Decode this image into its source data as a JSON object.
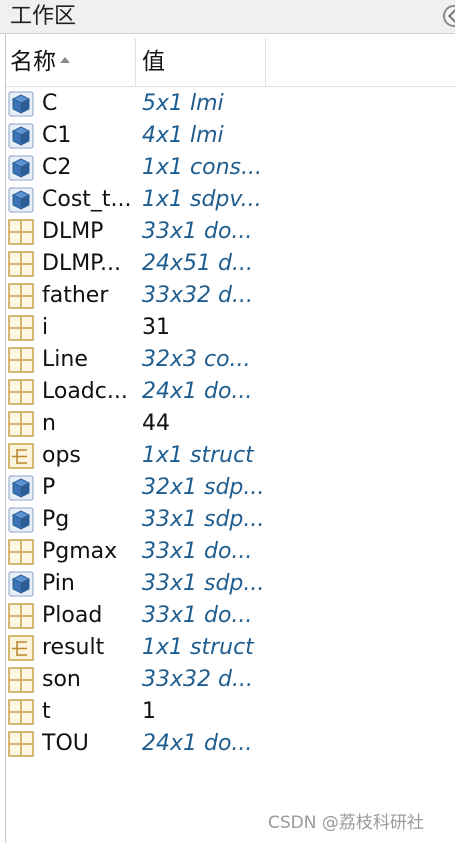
{
  "panel": {
    "title": "工作区"
  },
  "header": {
    "name_label": "名称",
    "value_label": "值"
  },
  "variables": [
    {
      "icon": "object-icon",
      "name": "C",
      "value": "5x1 lmi",
      "italic": true
    },
    {
      "icon": "object-icon",
      "name": "C1",
      "value": "4x1 lmi",
      "italic": true
    },
    {
      "icon": "object-icon",
      "name": "C2",
      "value": "1x1 cons...",
      "italic": true
    },
    {
      "icon": "object-icon",
      "name": "Cost_t...",
      "value": "1x1 sdpv...",
      "italic": true
    },
    {
      "icon": "matrix-icon",
      "name": "DLMP",
      "value": "33x1 do...",
      "italic": true
    },
    {
      "icon": "matrix-icon",
      "name": "DLMP...",
      "value": "24x51 d...",
      "italic": true
    },
    {
      "icon": "matrix-icon",
      "name": "father",
      "value": "33x32 d...",
      "italic": true
    },
    {
      "icon": "matrix-icon",
      "name": "i",
      "value": "31",
      "italic": false
    },
    {
      "icon": "matrix-icon",
      "name": "Line",
      "value": "32x3 co...",
      "italic": true
    },
    {
      "icon": "matrix-icon",
      "name": "Loadc...",
      "value": "24x1 do...",
      "italic": true
    },
    {
      "icon": "matrix-icon",
      "name": "n",
      "value": "44",
      "italic": false
    },
    {
      "icon": "struct-icon",
      "name": "ops",
      "value": "1x1 struct",
      "italic": true
    },
    {
      "icon": "object-icon",
      "name": "P",
      "value": "32x1 sdp...",
      "italic": true
    },
    {
      "icon": "object-icon",
      "name": "Pg",
      "value": "33x1 sdp...",
      "italic": true
    },
    {
      "icon": "matrix-icon",
      "name": "Pgmax",
      "value": "33x1 do...",
      "italic": true
    },
    {
      "icon": "object-icon",
      "name": "Pin",
      "value": "33x1 sdp...",
      "italic": true
    },
    {
      "icon": "matrix-icon",
      "name": "Pload",
      "value": "33x1 do...",
      "italic": true
    },
    {
      "icon": "struct-icon",
      "name": "result",
      "value": "1x1 struct",
      "italic": true
    },
    {
      "icon": "matrix-icon",
      "name": "son",
      "value": "33x32 d...",
      "italic": true
    },
    {
      "icon": "matrix-icon",
      "name": "t",
      "value": "1",
      "italic": false
    },
    {
      "icon": "matrix-icon",
      "name": "TOU",
      "value": "24x1 do...",
      "italic": true
    }
  ],
  "watermark": "CSDN @荔枝科研社",
  "colors": {
    "value_italic": "#1f5d8f",
    "matrix_grid": "#caa24a",
    "object_icon": "#3a76b5"
  }
}
